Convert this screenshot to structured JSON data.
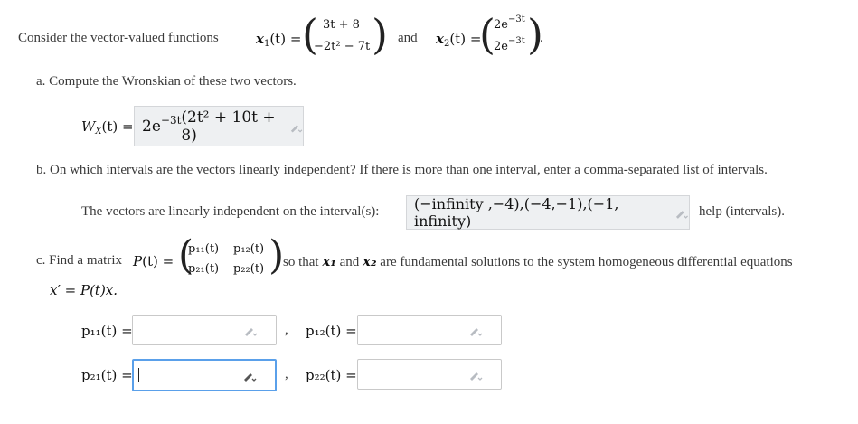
{
  "intro": {
    "prefix": "Consider the vector-valued functions",
    "x1_label": "x",
    "x1_sub": "1",
    "x1_arg": "(t) =",
    "x1_row1": "3t + 8",
    "x1_row2": "−2t² − 7t",
    "and": "and",
    "x2_label": "x",
    "x2_sub": "2",
    "x2_arg": "(t) =",
    "x2_row1_base": "2e",
    "x2_row1_exp": "−3t",
    "x2_row2_base": "2e",
    "x2_row2_exp": "−3t",
    "period": "."
  },
  "part_a": {
    "question": "a. Compute the Wronskian of these two vectors.",
    "lhs": "W",
    "lhs_sub": "X",
    "lhs_tail": "(t) =",
    "answer_pre": "2e",
    "answer_exp": "−3t",
    "answer_body": "(2t² + 10t + 8)"
  },
  "part_b": {
    "question": "b. On which intervals are the vectors linearly independent? If there is more than one interval, enter a comma-separated list of intervals.",
    "prompt": "The vectors are linearly independent on the interval(s):",
    "answer": "(−infinity ,−4),(−4,−1),(−1, infinity)",
    "help": "help (intervals)."
  },
  "part_c": {
    "question_prefix": "c. Find a matrix",
    "P": "P",
    "P_arg": "(t) =",
    "p11": "p₁₁(t)",
    "p12": "p₁₂(t)",
    "p21": "p₂₁(t)",
    "p22": "p₂₂(t)",
    "question_suffix_1": "so that",
    "x1": "x₁",
    "and": "and",
    "x2": "x₂",
    "question_suffix_2": "are fundamental solutions to the system homogeneous differential equations",
    "ode": "x′ = P(t)x.",
    "labels": {
      "p11": "p₁₁(t) =",
      "p12": "p₁₂(t) =",
      "p21": "p₂₁(t) =",
      "p22": "p₂₂(t) ="
    },
    "comma": ",",
    "inputs": {
      "p11": "",
      "p12": "",
      "p21": "",
      "p22": ""
    }
  }
}
